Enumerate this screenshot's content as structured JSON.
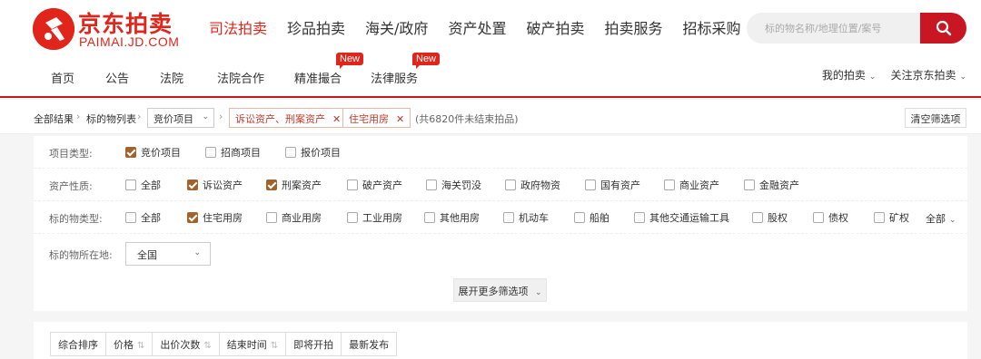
{
  "logo": {
    "cn": "京东拍卖",
    "en": "PAIMAI.JD.COM"
  },
  "main_nav": [
    "司法拍卖",
    "珍品拍卖",
    "海关/政府",
    "资产处置",
    "破产拍卖",
    "拍卖服务",
    "招标采购"
  ],
  "search": {
    "placeholder": "标的物名称/地理位置/案号"
  },
  "sub_nav": [
    {
      "label": "首页",
      "badge": ""
    },
    {
      "label": "公告",
      "badge": ""
    },
    {
      "label": "法院",
      "badge": ""
    },
    {
      "label": "法院合作",
      "badge": ""
    },
    {
      "label": "精准撮合",
      "badge": "New"
    },
    {
      "label": "法律服务",
      "badge": "New"
    }
  ],
  "right_links": {
    "my_auction": "我的拍卖",
    "follow": "关注京东拍卖"
  },
  "breadcrumb": {
    "all_results": "全部结果",
    "list": "标的物列表",
    "select_value": "竞价项目",
    "tag1": "诉讼资产、刑案资产",
    "tag2": "住宅用房",
    "count": "(共6820件未结束拍品)",
    "clear": "清空筛选项"
  },
  "filters": {
    "project_type": {
      "label": "项目类型:",
      "options": [
        {
          "label": "竞价项目",
          "checked": true
        },
        {
          "label": "招商项目",
          "checked": false
        },
        {
          "label": "报价项目",
          "checked": false
        }
      ]
    },
    "asset_nature": {
      "label": "资产性质:",
      "options": [
        {
          "label": "全部",
          "checked": false
        },
        {
          "label": "诉讼资产",
          "checked": true
        },
        {
          "label": "刑案资产",
          "checked": true
        },
        {
          "label": "破产资产",
          "checked": false
        },
        {
          "label": "海关罚没",
          "checked": false
        },
        {
          "label": "政府物资",
          "checked": false
        },
        {
          "label": "国有资产",
          "checked": false
        },
        {
          "label": "商业资产",
          "checked": false
        },
        {
          "label": "金融资产",
          "checked": false
        }
      ]
    },
    "object_type": {
      "label": "标的物类型:",
      "options": [
        {
          "label": "全部",
          "checked": false
        },
        {
          "label": "住宅用房",
          "checked": true
        },
        {
          "label": "商业用房",
          "checked": false
        },
        {
          "label": "工业用房",
          "checked": false
        },
        {
          "label": "其他用房",
          "checked": false
        },
        {
          "label": "机动车",
          "checked": false
        },
        {
          "label": "船舶",
          "checked": false
        },
        {
          "label": "其他交通运输工具",
          "checked": false
        },
        {
          "label": "股权",
          "checked": false
        },
        {
          "label": "债权",
          "checked": false
        },
        {
          "label": "矿权",
          "checked": false
        }
      ],
      "all_toggle": "全部"
    },
    "location": {
      "label": "标的物所在地:",
      "value": "全国"
    },
    "expand": "展开更多筛选项"
  },
  "sort": [
    {
      "label": "综合排序",
      "arrow": false
    },
    {
      "label": "价格",
      "arrow": true
    },
    {
      "label": "出价次数",
      "arrow": true
    },
    {
      "label": "结束时间",
      "arrow": true
    },
    {
      "label": "即将开拍",
      "arrow": false
    },
    {
      "label": "最新发布",
      "arrow": false
    }
  ],
  "colors": {
    "brand_red": "#e1251b",
    "checkbox_brown": "#a0632d"
  }
}
